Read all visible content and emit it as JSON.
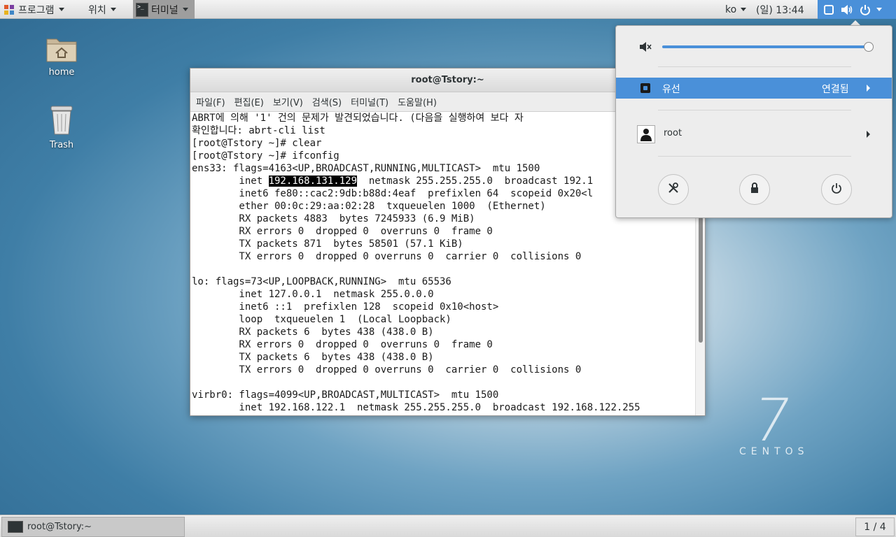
{
  "top_panel": {
    "applications_label": "프로그램",
    "places_label": "위치",
    "active_app_label": "터미널",
    "language_label": "ko",
    "clock": "(일) 13:44"
  },
  "desktop": {
    "icons": [
      {
        "label": "home",
        "icon": "home-folder-icon"
      },
      {
        "label": "Trash",
        "icon": "trash-icon"
      }
    ],
    "watermark_number": "7",
    "watermark_word": "CENTOS"
  },
  "terminal": {
    "title": "root@Tstory:~",
    "menu": [
      "파일(F)",
      "편집(E)",
      "보기(V)",
      "검색(S)",
      "터미널(T)",
      "도움말(H)"
    ],
    "highlighted_ip": "192.168.131.129",
    "lines": [
      "ABRT에 의해 '1' 건의 문제가 발견되었습니다. (다음을 실행하여 보다 자",
      "확인합니다: abrt-cli list",
      "[root@Tstory ~]# clear",
      "[root@Tstory ~]# ifconfig",
      "ens33: flags=4163<UP,BROADCAST,RUNNING,MULTICAST>  mtu 1500",
      "        inet __HL__  netmask 255.255.255.0  broadcast 192.1",
      "        inet6 fe80::cac2:9db:b88d:4eaf  prefixlen 64  scopeid 0x20<l",
      "        ether 00:0c:29:aa:02:28  txqueuelen 1000  (Ethernet)",
      "        RX packets 4883  bytes 7245933 (6.9 MiB)",
      "        RX errors 0  dropped 0  overruns 0  frame 0",
      "        TX packets 871  bytes 58501 (57.1 KiB)",
      "        TX errors 0  dropped 0 overruns 0  carrier 0  collisions 0",
      "",
      "lo: flags=73<UP,LOOPBACK,RUNNING>  mtu 65536",
      "        inet 127.0.0.1  netmask 255.0.0.0",
      "        inet6 ::1  prefixlen 128  scopeid 0x10<host>",
      "        loop  txqueuelen 1  (Local Loopback)",
      "        RX packets 6  bytes 438 (438.0 B)",
      "        RX errors 0  dropped 0  overruns 0  frame 0",
      "        TX packets 6  bytes 438 (438.0 B)",
      "        TX errors 0  dropped 0 overruns 0  carrier 0  collisions 0",
      "",
      "virbr0: flags=4099<UP,BROADCAST,MULTICAST>  mtu 1500",
      "        inet 192.168.122.1  netmask 255.255.255.0  broadcast 192.168.122.255"
    ]
  },
  "status_menu": {
    "volume_level": 0.98,
    "wired_label": "유선",
    "wired_status": "연결됨",
    "user_label": "root",
    "buttons": [
      "settings-icon",
      "lock-icon",
      "power-icon"
    ]
  },
  "bottom_panel": {
    "task_label": "root@Tstory:~",
    "workspace": "1 / 4"
  },
  "colors": {
    "accent": "#4a90d9",
    "panel": "#e6e6e6"
  }
}
